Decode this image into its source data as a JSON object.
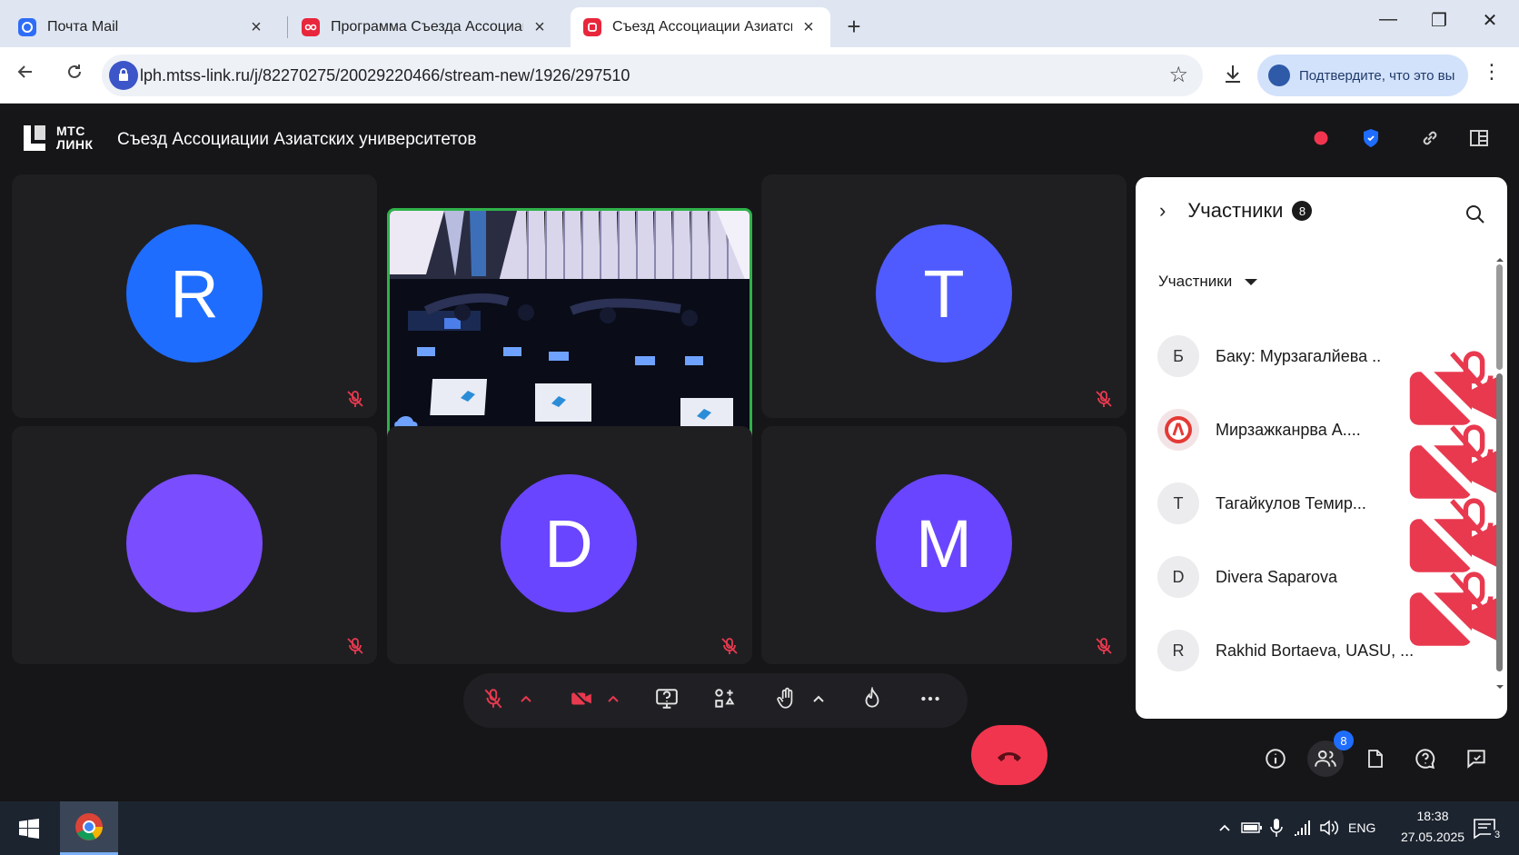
{
  "browser": {
    "tabs": [
      {
        "title": "Почта Mail",
        "close": "×"
      },
      {
        "title": "Программа Съезда Ассоциаци",
        "close": "×"
      },
      {
        "title": "Съезд Ассоциации Азиатски",
        "close": "×"
      }
    ],
    "new_tab": "+",
    "window_controls": {
      "minimize": "—",
      "maximize": "❐",
      "close": "✕"
    },
    "url": "lph.mtss-link.ru/j/82270275/20029220466/stream-new/1926/297510",
    "verify_label": "Подтвердите, что это вы"
  },
  "app": {
    "brand": {
      "line1": "МТС",
      "line2": "ЛИНК"
    },
    "title": "Съезд Ассоциации Азиатских университетов",
    "colors": {
      "recording": "#f2354f",
      "accent": "#1f6dff",
      "hangup": "#f2354f",
      "video_border": "#2fb24a",
      "mic_off": "#e8394f"
    },
    "tiles": [
      {
        "initial": "R",
        "color": "#1f6dff"
      },
      {
        "initial": "",
        "color": "#7a4dff",
        "video": true
      },
      {
        "initial": "T",
        "color": "#4f5bff"
      },
      {
        "initial": "",
        "color": "#7a4dff"
      },
      {
        "initial": "D",
        "color": "#6a45ff"
      },
      {
        "initial": "M",
        "color": "#6a45ff"
      }
    ]
  },
  "participants": {
    "title": "Участники",
    "count": "8",
    "filter": "Участники",
    "items": [
      {
        "avatar": "Б",
        "name": "Баку: Мурзагалйева ..."
      },
      {
        "avatar": "",
        "name": "Мирзажканрва А...."
      },
      {
        "avatar": "Т",
        "name": "Тагайкулов Темир..."
      },
      {
        "avatar": "D",
        "name": "Divera Saparova"
      },
      {
        "avatar": "R",
        "name": "Rakhid Bortaeva, UASU, ..."
      }
    ]
  },
  "controls": {
    "participants_badge": "8"
  },
  "taskbar": {
    "lang": "ENG",
    "time": "18:38",
    "date": "27.05.2025",
    "notifications": "3"
  }
}
